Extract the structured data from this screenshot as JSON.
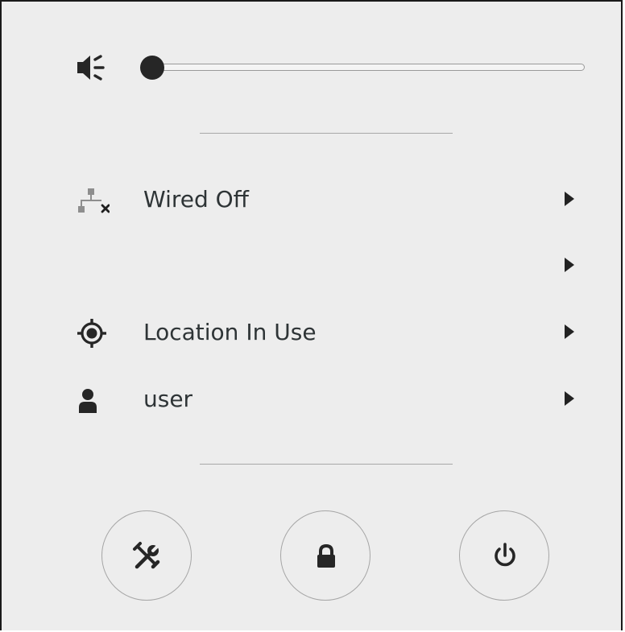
{
  "volume": {
    "icon": "audio-volume-muted-icon",
    "level": 0
  },
  "rows": [
    {
      "icon": "network-wired-disconnected-icon",
      "label": "Wired Off",
      "has_submenu": true
    },
    {
      "icon": "",
      "label": "",
      "has_submenu": true
    },
    {
      "icon": "location-icon",
      "label": "Location In Use",
      "has_submenu": true
    },
    {
      "icon": "user-icon",
      "label": "user",
      "has_submenu": true
    }
  ],
  "buttons": [
    {
      "icon": "settings-tools-icon"
    },
    {
      "icon": "lock-icon"
    },
    {
      "icon": "power-icon"
    }
  ],
  "colors": {
    "background": "#ededed",
    "text": "#2e3436",
    "icon": "#262626",
    "separator": "#a8a8a8"
  }
}
